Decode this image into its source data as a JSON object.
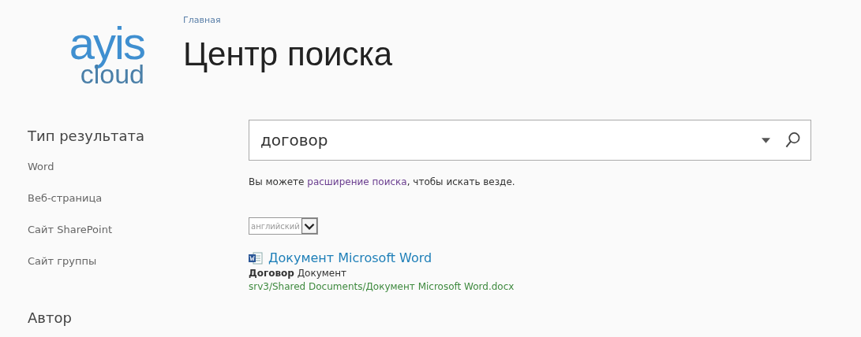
{
  "logo": {
    "top": "ayis",
    "bottom": "cloud"
  },
  "breadcrumb": "Главная",
  "title": "Центр поиска",
  "sidebar": {
    "sections": [
      {
        "heading": "Тип результата",
        "items": [
          "Word",
          "Веб-страница",
          "Сайт SharePoint",
          "Сайт группы"
        ]
      },
      {
        "heading": "Автор"
      }
    ]
  },
  "search": {
    "value": "договор"
  },
  "hint": {
    "before": "Вы можете ",
    "link": "расширение поиска",
    "after": ", чтобы искать везде."
  },
  "language": {
    "value": "английский"
  },
  "results": [
    {
      "kind": "word",
      "title": "Документ Microsoft Word",
      "snippet": "**Договор** Документ",
      "url": "srv3/Shared Documents/Документ Microsoft Word.docx"
    }
  ]
}
